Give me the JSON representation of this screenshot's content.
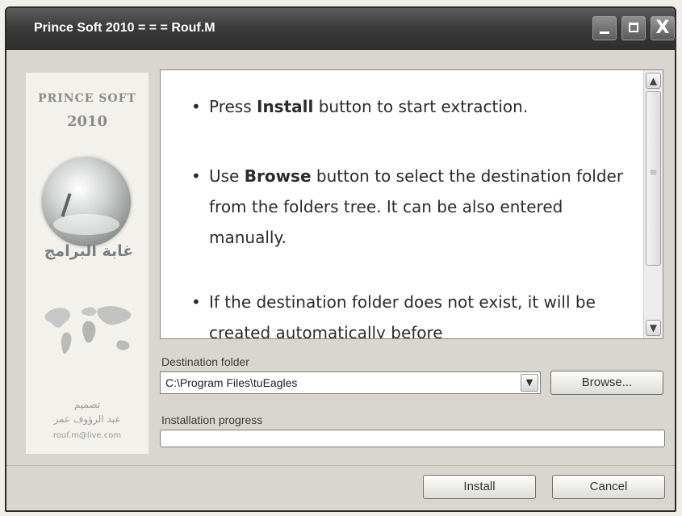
{
  "window": {
    "title": "Prince Soft 2010 = = = Rouf.M",
    "close_glyph": "X"
  },
  "sidebar": {
    "brand_line1": "PRINCE SOFT",
    "brand_line2": "2010",
    "arabic_logo": "غابة البرامج",
    "credit_line1": "تصميم",
    "credit_line2": "عبد الرؤوف عمر",
    "credit_line3": "rouf.m@live.com"
  },
  "instructions": {
    "bullets": [
      {
        "before": "Press ",
        "bold": "Install",
        "after": " button to start extraction."
      },
      {
        "before": "Use ",
        "bold": "Browse",
        "after": " button to select the destination folder from the folders tree. It can be also entered manually."
      },
      {
        "before": "",
        "bold": "",
        "after": "If the destination folder does not exist, it will be created automatically before"
      }
    ]
  },
  "destination": {
    "label": "Destination folder",
    "value": "C:\\Program Files\\tuEagles",
    "browse_label": "Browse..."
  },
  "progress": {
    "label": "Installation progress",
    "value_percent": 0
  },
  "footer": {
    "install_label": "Install",
    "cancel_label": "Cancel"
  },
  "colors": {
    "titlebar": "#3b3b3b",
    "window_bg": "#d8d6cf",
    "progress_fill": "#4c9a3a"
  },
  "icons": [
    "minimize-icon",
    "maximize-icon",
    "close-icon",
    "scroll-up-arrow-icon",
    "scroll-down-arrow-icon",
    "dropdown-arrow-icon",
    "globe-logo-icon",
    "world-map-icon"
  ]
}
